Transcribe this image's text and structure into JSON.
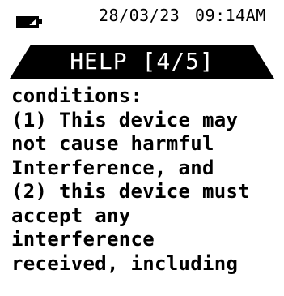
{
  "status_bar": {
    "battery_icon": "battery-icon",
    "date": "28/03/23",
    "time": "09:14AM"
  },
  "title": {
    "text": "HELP [4/5]"
  },
  "help": {
    "lines": [
      "conditions:",
      "(1) This device may",
      "not cause harmful",
      "Interference, and",
      "(2) this device must",
      "accept any",
      "interference",
      "received, including"
    ]
  },
  "colors": {
    "background": "#ffffff",
    "text": "#000000",
    "banner": "#000000",
    "banner_text": "#ffffff"
  }
}
